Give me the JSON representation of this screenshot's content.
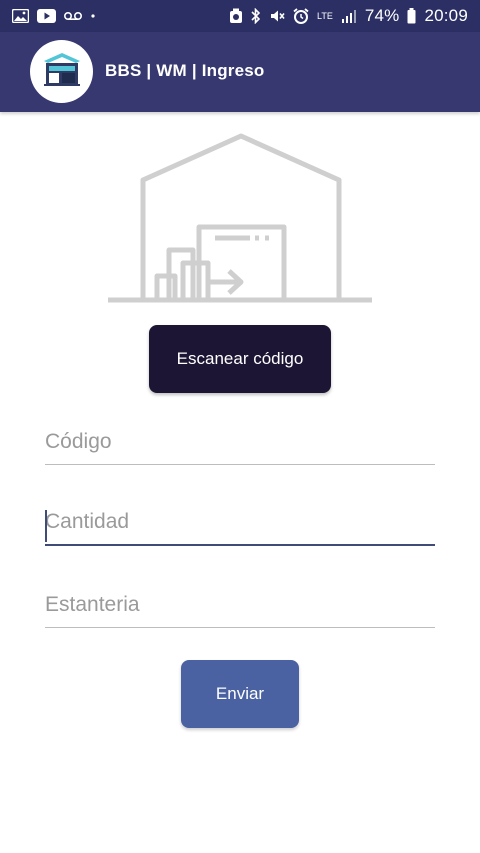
{
  "status_bar": {
    "left_icons": [
      "image-icon",
      "youtube-icon",
      "voicemail-icon",
      "dot-icon"
    ],
    "right_icons": [
      "alarm-clock-icon",
      "bluetooth-icon",
      "mute-icon",
      "alarm-icon",
      "lte-icon",
      "signal-icon",
      "battery-icon"
    ],
    "lte_label": "LTE",
    "battery": "74%",
    "time": "20:09"
  },
  "app_bar": {
    "title": "BBS | WM | Ingreso",
    "logo_icon": "warehouse-logo-icon",
    "colors": {
      "background": "#37386f",
      "status_bar": "#2b2f63"
    }
  },
  "illustration": {
    "icon": "warehouse-boxes-icon"
  },
  "scan": {
    "label": "Escanear código",
    "color": "#1c1533"
  },
  "form": {
    "codigo_placeholder": "Código",
    "cantidad_placeholder": "Cantidad",
    "estanteria_placeholder": "Estanteria",
    "focused_field": "Cantidad"
  },
  "submit": {
    "label": "Enviar",
    "color": "#4a62a1"
  }
}
